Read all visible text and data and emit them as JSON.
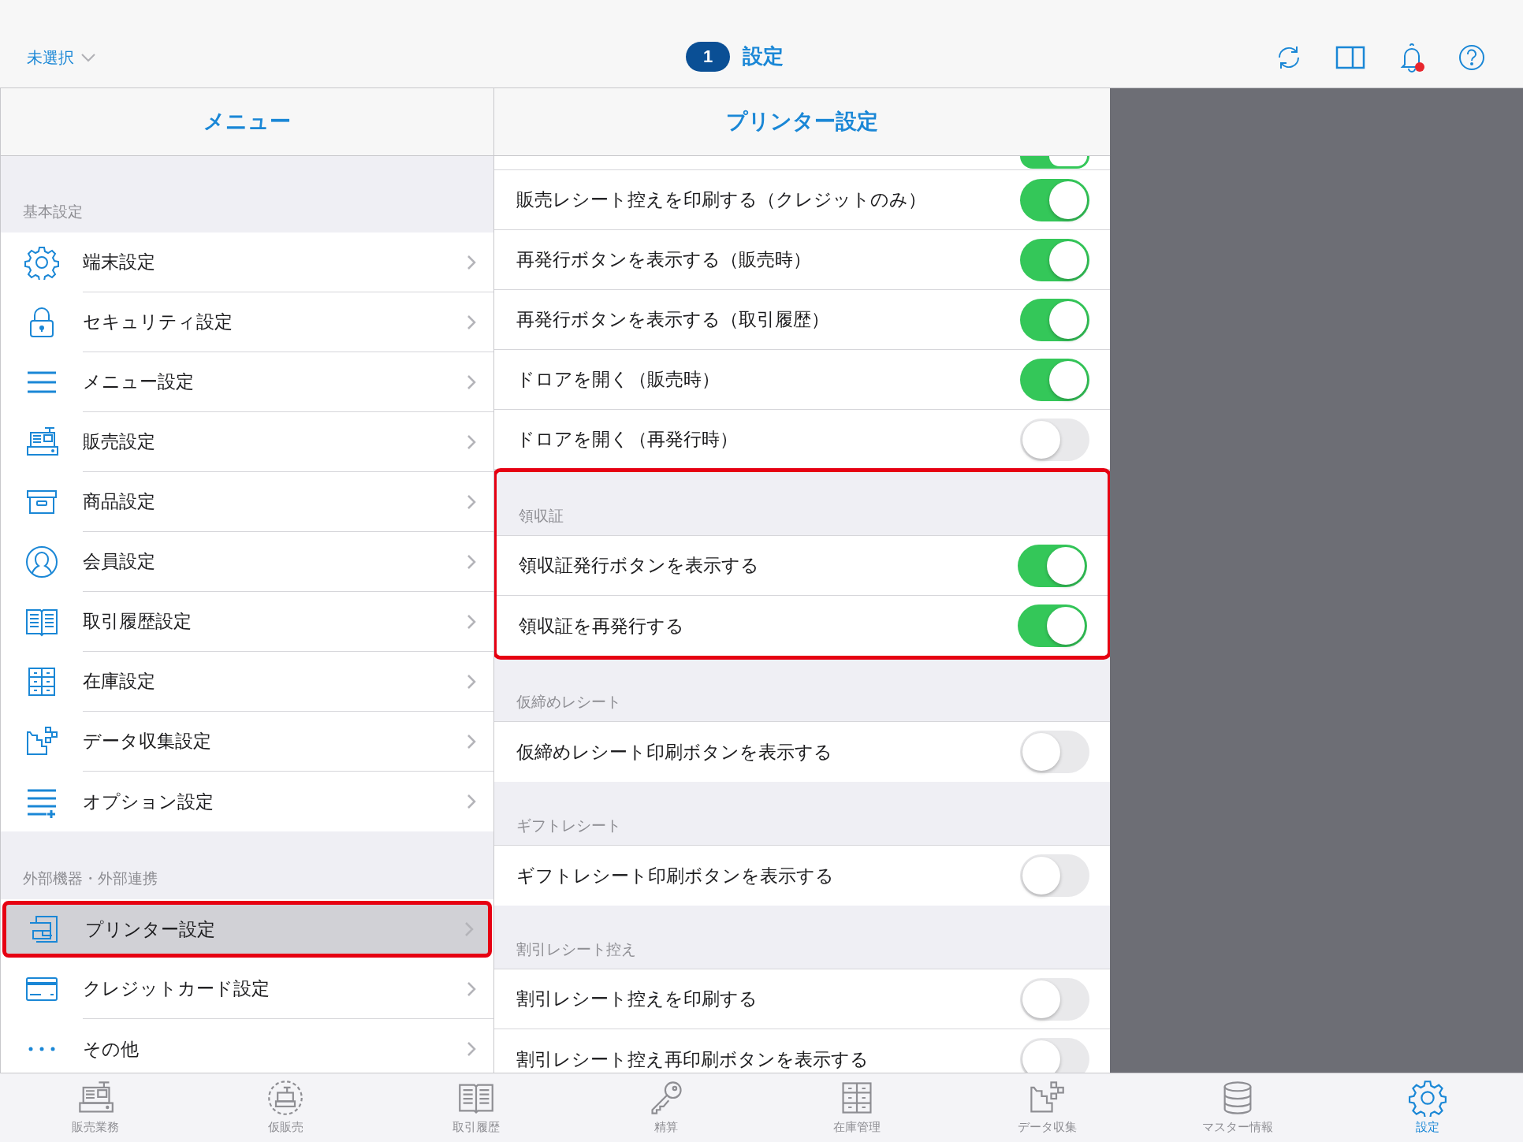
{
  "top_bar": {
    "store_selector": "未選択",
    "badge": "1",
    "title": "設定"
  },
  "menu": {
    "title": "メニュー",
    "sections": [
      {
        "header": "基本設定",
        "items": [
          {
            "label": "端末設定",
            "selected": false,
            "highlighted": false
          },
          {
            "label": "セキュリティ設定",
            "selected": false,
            "highlighted": false
          },
          {
            "label": "メニュー設定",
            "selected": false,
            "highlighted": false
          },
          {
            "label": "販売設定",
            "selected": false,
            "highlighted": false
          },
          {
            "label": "商品設定",
            "selected": false,
            "highlighted": false
          },
          {
            "label": "会員設定",
            "selected": false,
            "highlighted": false
          },
          {
            "label": "取引履歴設定",
            "selected": false,
            "highlighted": false
          },
          {
            "label": "在庫設定",
            "selected": false,
            "highlighted": false
          },
          {
            "label": "データ収集設定",
            "selected": false,
            "highlighted": false
          },
          {
            "label": "オプション設定",
            "selected": false,
            "highlighted": false
          }
        ]
      },
      {
        "header": "外部機器・外部連携",
        "items": [
          {
            "label": "プリンター設定",
            "selected": true,
            "highlighted": true
          },
          {
            "label": "クレジットカード設定",
            "selected": false,
            "highlighted": false
          },
          {
            "label": "その他",
            "selected": false,
            "highlighted": false
          }
        ]
      }
    ]
  },
  "printer_settings": {
    "title": "プリンター設定",
    "partial_row": {
      "on": true
    },
    "sections": [
      {
        "highlighted": false,
        "rows": [
          {
            "label": "販売レシート控えを印刷する（クレジットのみ）",
            "on": true
          },
          {
            "label": "再発行ボタンを表示する（販売時）",
            "on": true
          },
          {
            "label": "再発行ボタンを表示する（取引履歴）",
            "on": true
          },
          {
            "label": "ドロアを開く（販売時）",
            "on": true
          },
          {
            "label": "ドロアを開く（再発行時）",
            "on": false
          }
        ]
      },
      {
        "header": "領収証",
        "highlighted": true,
        "rows": [
          {
            "label": "領収証発行ボタンを表示する",
            "on": true
          },
          {
            "label": "領収証を再発行する",
            "on": true
          }
        ]
      },
      {
        "header": "仮締めレシート",
        "highlighted": false,
        "rows": [
          {
            "label": "仮締めレシート印刷ボタンを表示する",
            "on": false
          }
        ]
      },
      {
        "header": "ギフトレシート",
        "highlighted": false,
        "rows": [
          {
            "label": "ギフトレシート印刷ボタンを表示する",
            "on": false
          }
        ]
      },
      {
        "header": "割引レシート控え",
        "highlighted": false,
        "rows": [
          {
            "label": "割引レシート控えを印刷する",
            "on": false
          },
          {
            "label": "割引レシート控え再印刷ボタンを表示する",
            "on": false
          }
        ]
      }
    ]
  },
  "tab_bar": [
    {
      "label": "販売業務",
      "selected": false
    },
    {
      "label": "仮販売",
      "selected": false
    },
    {
      "label": "取引履歴",
      "selected": false
    },
    {
      "label": "精算",
      "selected": false
    },
    {
      "label": "在庫管理",
      "selected": false
    },
    {
      "label": "データ収集",
      "selected": false
    },
    {
      "label": "マスター情報",
      "selected": false
    },
    {
      "label": "設定",
      "selected": true
    }
  ]
}
